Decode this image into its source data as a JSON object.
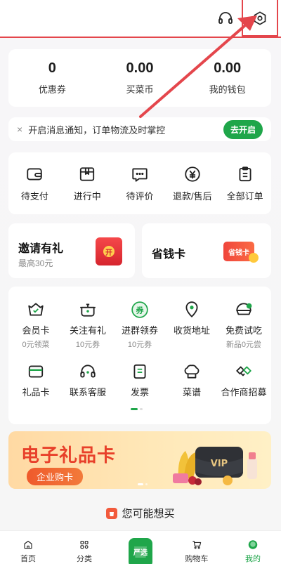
{
  "stats": [
    {
      "value": "0",
      "label": "优惠券"
    },
    {
      "value": "0.00",
      "label": "买菜币"
    },
    {
      "value": "0.00",
      "label": "我的钱包"
    }
  ],
  "notice": {
    "close": "×",
    "text": "开启消息通知，订单物流及时掌控",
    "button": "去开启"
  },
  "orders": [
    {
      "label": "待支付",
      "icon": "wallet-icon"
    },
    {
      "label": "进行中",
      "icon": "package-icon"
    },
    {
      "label": "待评价",
      "icon": "comment-icon"
    },
    {
      "label": "退款/售后",
      "icon": "refund-icon"
    },
    {
      "label": "全部订单",
      "icon": "clipboard-icon"
    }
  ],
  "promos": {
    "invite": {
      "title": "邀请有礼",
      "sub": "最高30元",
      "icon_text": "开"
    },
    "savings": {
      "title": "省钱卡",
      "icon_text": "省钱卡"
    }
  },
  "services": [
    {
      "label": "会员卡",
      "sub": "0元领菜",
      "icon": "basket-icon"
    },
    {
      "label": "关注有礼",
      "sub": "10元券",
      "icon": "pot-icon"
    },
    {
      "label": "进群领券",
      "sub": "10元券",
      "icon": "coupon-icon"
    },
    {
      "label": "收货地址",
      "sub": "",
      "icon": "location-icon"
    },
    {
      "label": "免费试吃",
      "sub": "新品0元尝",
      "icon": "free-tasting-icon"
    },
    {
      "label": "礼品卡",
      "sub": "",
      "icon": "gift-card-icon"
    },
    {
      "label": "联系客服",
      "sub": "",
      "icon": "headset-icon"
    },
    {
      "label": "发票",
      "sub": "",
      "icon": "invoice-icon"
    },
    {
      "label": "菜谱",
      "sub": "",
      "icon": "chef-hat-icon"
    },
    {
      "label": "合作商招募",
      "sub": "",
      "icon": "handshake-icon"
    }
  ],
  "banner": {
    "title": "电子礼品卡",
    "button": "企业购卡",
    "badge": "VIP"
  },
  "recommend_title": "您可能想买",
  "tabs": [
    {
      "label": "首页",
      "icon": "home-icon"
    },
    {
      "label": "分类",
      "icon": "category-icon"
    },
    {
      "label": "",
      "icon": "shopping-bag-icon"
    },
    {
      "label": "购物车",
      "icon": "cart-icon"
    },
    {
      "label": "我的",
      "icon": "profile-icon"
    }
  ],
  "tab_center_text": "严选",
  "colors": {
    "accent": "#1fa64a",
    "red": "#e4464c",
    "banner_red": "#e8402a"
  }
}
